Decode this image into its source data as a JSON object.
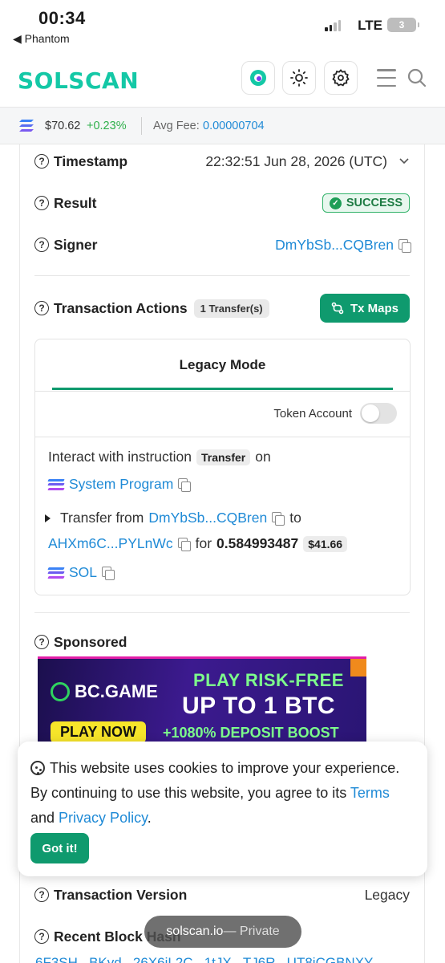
{
  "status": {
    "time": "00:34",
    "back": "◀ Phantom",
    "network": "LTE",
    "battery": "3"
  },
  "header": {
    "logo": "SOLSCAN"
  },
  "pricebar": {
    "price": "$70.62",
    "change": "+0.23%",
    "fee_label": "Avg Fee:",
    "fee_value": "0.00000704"
  },
  "details": {
    "timestamp": {
      "label": "Timestamp",
      "value": "22:32:51 Jun 28, 2026 (UTC)"
    },
    "result": {
      "label": "Result",
      "value": "SUCCESS"
    },
    "signer": {
      "label": "Signer",
      "value": "DmYbSb...CQBren"
    },
    "actions": {
      "label": "Transaction Actions",
      "count": "1 Transfer(s)",
      "txmaps": "Tx Maps"
    }
  },
  "legacy": {
    "mode": "Legacy Mode",
    "token_account": "Token Account",
    "line1_a": "Interact with instruction",
    "line1_chip": "Transfer",
    "line1_b": "on",
    "program": "System Program",
    "line2_a": "Transfer from",
    "from": "DmYbSb...CQBren",
    "to_word": "to",
    "to": "AHXm6C...PYLnWc",
    "for_word": "for",
    "amount": "0.584993487",
    "usd": "$41.66",
    "token": "SOL"
  },
  "sponsored": {
    "label": "Sponsored",
    "brand": "BC.GAME",
    "line1": "PLAY RISK-FREE",
    "line2": "UP TO 1 BTC",
    "cta": "PLAY NOW",
    "line3": "+1080% DEPOSIT BOOST"
  },
  "cookie": {
    "text_a": "This website uses cookies to improve your experience. By continuing to use this website, you agree to its ",
    "terms": "Terms",
    "and": " and ",
    "privacy": "Privacy Policy",
    "dot": ".",
    "button": "Got it!"
  },
  "more": {
    "version_label": "Transaction Version",
    "version_value": "Legacy",
    "recent_label": "Recent Block Hash",
    "recent_value": "6F3SH...BKvd...26X6iL2C...1tJX...TJ6R...UT8iCGBNXY"
  },
  "browser": {
    "domain": "solscan.io",
    "mode": " — Private"
  },
  "colors": {
    "accent": "#0f9a6e",
    "link": "#1f8ad6",
    "success": "#1e9e57",
    "logo": "#14c8a6"
  }
}
